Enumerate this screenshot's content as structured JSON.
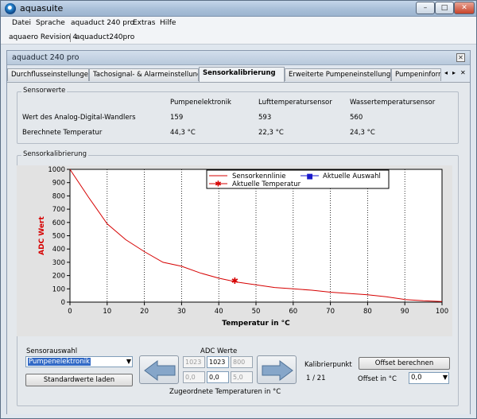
{
  "window": {
    "title": "aquasuite",
    "min": "–",
    "max": "□",
    "close": "✕"
  },
  "menu": [
    "Datei",
    "Sprache",
    "aquaduct 240 pro",
    "Extras",
    "Hilfe"
  ],
  "devices": [
    "aquaero Revision 4",
    "aquaduct240pro"
  ],
  "subwindow": {
    "title": "aquaduct 240 pro",
    "close": "✕"
  },
  "tabs": [
    "Durchflusseinstellungen",
    "Tachosignal- & Alarmeinstellungen",
    "Sensorkalibrierung",
    "Erweiterte Pumpeneinstellungen",
    "Pumpeninform"
  ],
  "tab_scroll": {
    "left": "◂",
    "right": "▸",
    "close": "✕"
  },
  "sensorwerte": {
    "label": "Sensorwerte",
    "headers": [
      "Pumpenelektronik",
      "Lufttemperatursensor",
      "Wassertemperatursensor"
    ],
    "rows": [
      {
        "label": "Wert des Analog-Digital-Wandlers",
        "values": [
          "159",
          "593",
          "560"
        ]
      },
      {
        "label": "Berechnete Temperatur",
        "values": [
          "44,3 °C",
          "22,3 °C",
          "24,3 °C"
        ]
      }
    ]
  },
  "kalibrierung": {
    "label": "Sensorkalibrierung"
  },
  "chart_data": {
    "type": "line",
    "xlabel": "Temperatur in °C",
    "ylabel": "ADC Wert",
    "xlim": [
      0,
      100
    ],
    "ylim": [
      0,
      1000
    ],
    "xticks": [
      "0",
      "10",
      "20",
      "30",
      "40",
      "50",
      "60",
      "70",
      "80",
      "90",
      "100"
    ],
    "yticks": [
      "0",
      "100",
      "200",
      "300",
      "400",
      "500",
      "600",
      "700",
      "800",
      "900",
      "1000"
    ],
    "grid": "vertical dotted",
    "legend_position": "top-right",
    "series": [
      {
        "name": "Sensorkennlinie",
        "color": "#d60000",
        "x": [
          0,
          5,
          10,
          15,
          20,
          25,
          30,
          35,
          40,
          45,
          50,
          55,
          60,
          65,
          70,
          75,
          80,
          85,
          90,
          95,
          100
        ],
        "y": [
          1000,
          790,
          590,
          470,
          380,
          300,
          270,
          220,
          180,
          150,
          130,
          110,
          100,
          90,
          75,
          65,
          55,
          40,
          20,
          10,
          5
        ]
      }
    ],
    "current_temperature": {
      "name": "Aktuelle Temperatur",
      "x": 44.3,
      "y": 159,
      "color": "#d60000",
      "marker": "✱"
    },
    "current_selection": {
      "name": "Aktuelle Auswahl",
      "color": "#1a1acc",
      "marker": "■"
    }
  },
  "controls": {
    "sensorauswahl_label": "Sensorauswahl",
    "sensor_selected": "Pumpenelektronik",
    "standardwerte_button": "Standardwerte laden",
    "adc_label": "ADC Werte",
    "adc_values": [
      "1023",
      "1023",
      "800"
    ],
    "temp_values": [
      "0,0",
      "0,0",
      "5,0"
    ],
    "zugeordnete_label": "Zugeordnete Temperaturen in °C",
    "kalibrierpunkt_label": "Kalibrierpunkt",
    "kalibrierpunkt_value": "1 / 21",
    "offset_button": "Offset berechnen",
    "offset_label": "Offset in °C",
    "offset_value": "0,0"
  },
  "colors": {
    "accent": "#3169c6",
    "curve": "#d60000",
    "axis_label": "#d60000"
  }
}
